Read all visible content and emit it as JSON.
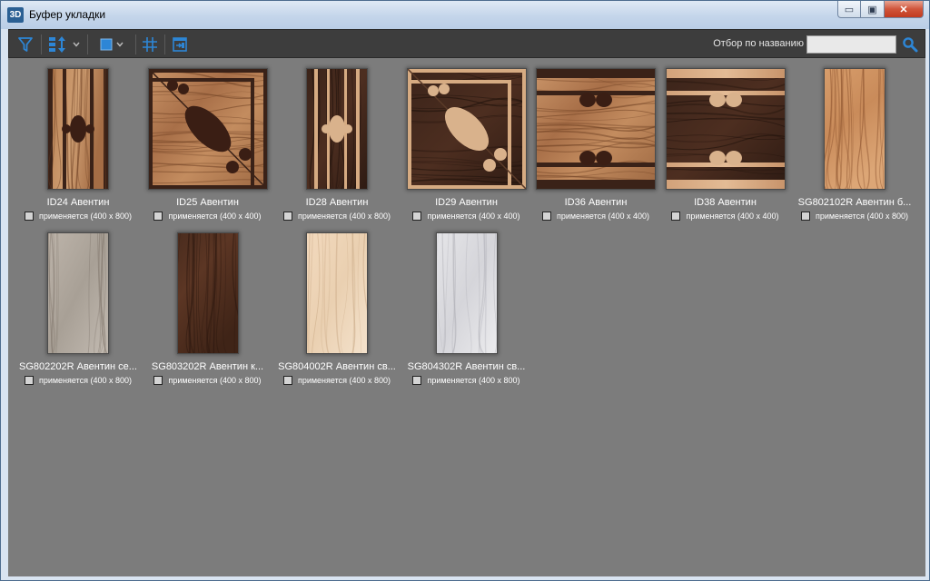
{
  "window": {
    "app_icon_text": "3D",
    "title": "Буфер укладки",
    "minimize_glyph": "▭",
    "maximize_glyph": "▣",
    "close_glyph": "✕"
  },
  "toolbar": {
    "filter_icon": "filter-icon",
    "sort_icon": "sort-icon",
    "view_icon": "view-mode-icon",
    "grid_icon": "grid-icon",
    "apply_icon": "apply-icon",
    "search_label": "Отбор по названию",
    "search_value": "",
    "search_icon": "search-icon"
  },
  "colors": {
    "toolbar_bg": "#3d3d3d",
    "content_bg": "#7c7c7c",
    "accent": "#2d86d6"
  },
  "tiles": [
    {
      "name": "ID24 Авентин",
      "status": "применяется (400 x 800)",
      "checked": false,
      "pattern": "ID24"
    },
    {
      "name": "ID25 Авентин",
      "status": "применяется (400 x 400)",
      "checked": false,
      "pattern": "ID25"
    },
    {
      "name": "ID28 Авентин",
      "status": "применяется (400 x 800)",
      "checked": false,
      "pattern": "ID28"
    },
    {
      "name": "ID29 Авентин",
      "status": "применяется (400 x 400)",
      "checked": false,
      "pattern": "ID29"
    },
    {
      "name": "ID36 Авентин",
      "status": "применяется (400 x 400)",
      "checked": false,
      "pattern": "ID36"
    },
    {
      "name": "ID38 Авентин",
      "status": "применяется (400 x 400)",
      "checked": false,
      "pattern": "ID38"
    },
    {
      "name": "SG802102R Авентин б...",
      "status": "применяется (400 x 800)",
      "checked": false,
      "pattern": "light-wood"
    },
    {
      "name": "SG802202R Авентин се...",
      "status": "применяется (400 x 800)",
      "checked": false,
      "pattern": "grey-marble"
    },
    {
      "name": "SG803202R Авентин к...",
      "status": "применяется (400 x 800)",
      "checked": false,
      "pattern": "dark-wood"
    },
    {
      "name": "SG804002R Авентин св...",
      "status": "применяется (400 x 800)",
      "checked": false,
      "pattern": "cream-marble"
    },
    {
      "name": "SG804302R Авентин св...",
      "status": "применяется (400 x 800)",
      "checked": false,
      "pattern": "white-marble"
    }
  ]
}
